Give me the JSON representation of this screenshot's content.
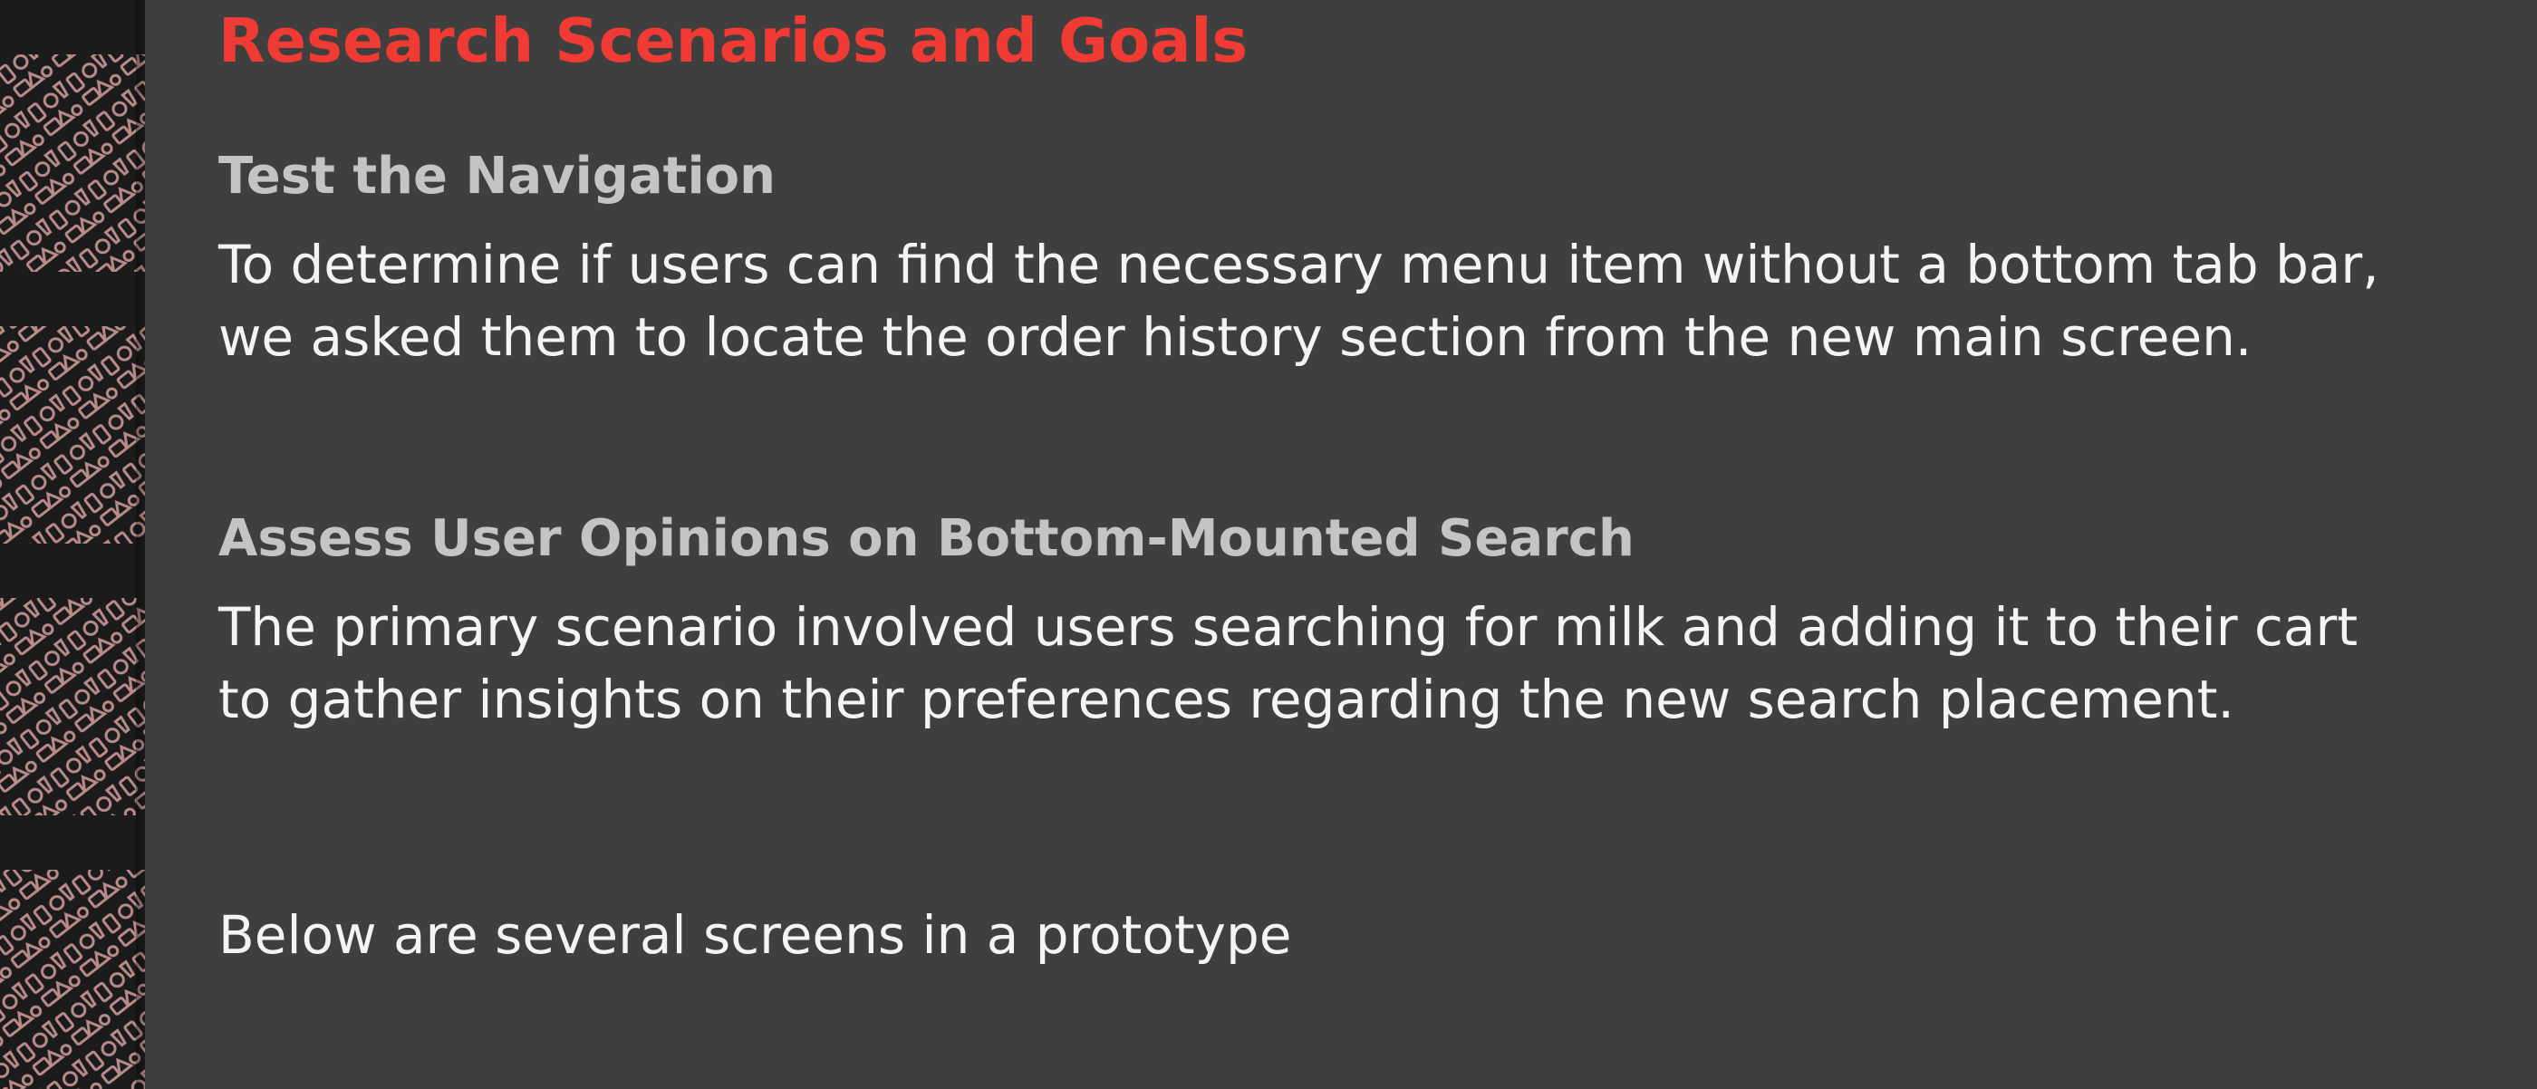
{
  "section": {
    "title": "Research Scenarios and Goals"
  },
  "scenarios": [
    {
      "heading": "Test the Navigation",
      "text": "To determine if users can find the necessary menu item without a bottom tab bar, we asked them to locate the order history section from the new main screen."
    },
    {
      "heading": "Assess User Opinions on Bottom-Mounted Search",
      "text": "The primary scenario involved users searching for milk and adding it to their cart to gather insights on their preferences regarding the new search placement."
    }
  ],
  "footer_note": "Below are several screens in a prototype",
  "colors": {
    "background": "#3f3f3f",
    "title": "#ef3b33",
    "heading": "#c4c4c4",
    "body": "#f4f4f4",
    "strip": "#1b1b1b",
    "pattern": "#b88a8a"
  },
  "icons": {
    "side_pattern": "grocery-items-pattern"
  }
}
